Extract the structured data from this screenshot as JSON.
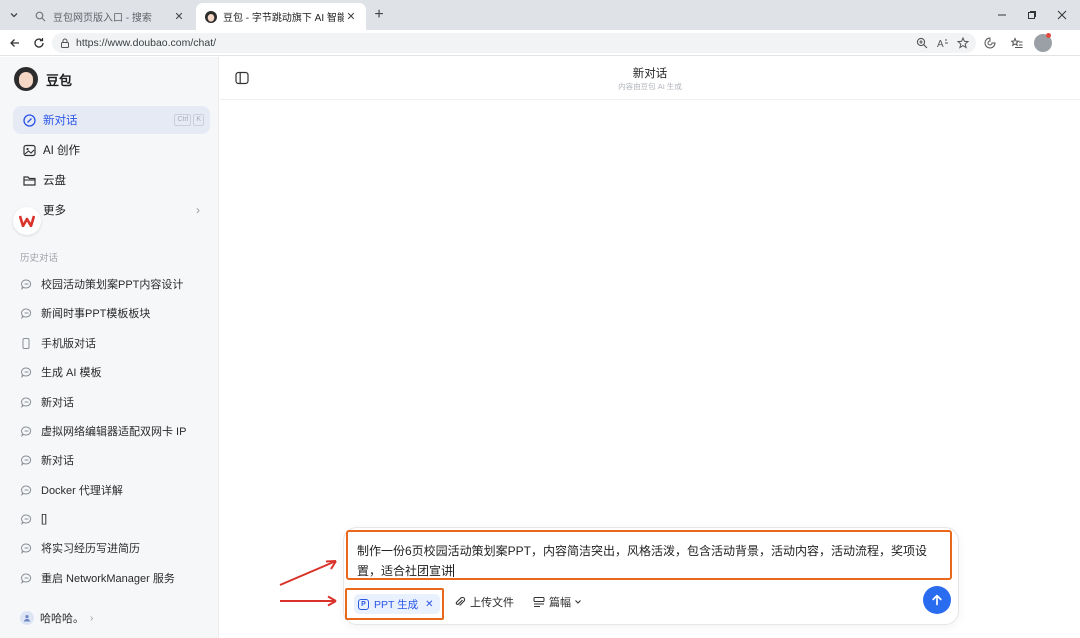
{
  "browser": {
    "tabs": [
      {
        "title": "豆包网页版入口 - 搜索",
        "active": false
      },
      {
        "title": "豆包 - 字节跳动旗下 AI 智能助手",
        "active": true
      }
    ],
    "url": "https://www.doubao.com/chat/"
  },
  "sidebar": {
    "brand": "豆包",
    "nav": [
      {
        "label": "新对话",
        "icon": "new-chat-icon",
        "shortcut": [
          "Ctrl",
          "K"
        ]
      },
      {
        "label": "AI 创作",
        "icon": "image-icon"
      },
      {
        "label": "云盘",
        "icon": "folder-icon"
      },
      {
        "label": "更多",
        "icon": "grid-icon"
      }
    ],
    "history_title": "历史对话",
    "history": [
      "校园活动策划案PPT内容设计",
      "新闻时事PPT模板板块",
      "手机版对话",
      "生成 AI 模板",
      "新对话",
      "虚拟网络编辑器适配双网卡 IP",
      "新对话",
      "Docker 代理详解",
      "[]",
      "将实习经历写进简历",
      "重启 NetworkManager 服务"
    ],
    "user": "哈哈哈。"
  },
  "main": {
    "title": "新对话",
    "subtitle": "内容由豆包 AI 生成",
    "prompt": "制作一份6页校园活动策划案PPT，内容简洁突出，风格活泼，包含活动背景，活动内容，活动流程，奖项设置，适合社团宣讲",
    "skill_chip": "PPT 生成",
    "tools": {
      "upload": "上传文件",
      "length": "篇幅"
    }
  },
  "colors": {
    "accent": "#2a56e8",
    "send": "#2a6cf0",
    "highlight": "#e8691c",
    "arrow": "#d9322a"
  }
}
